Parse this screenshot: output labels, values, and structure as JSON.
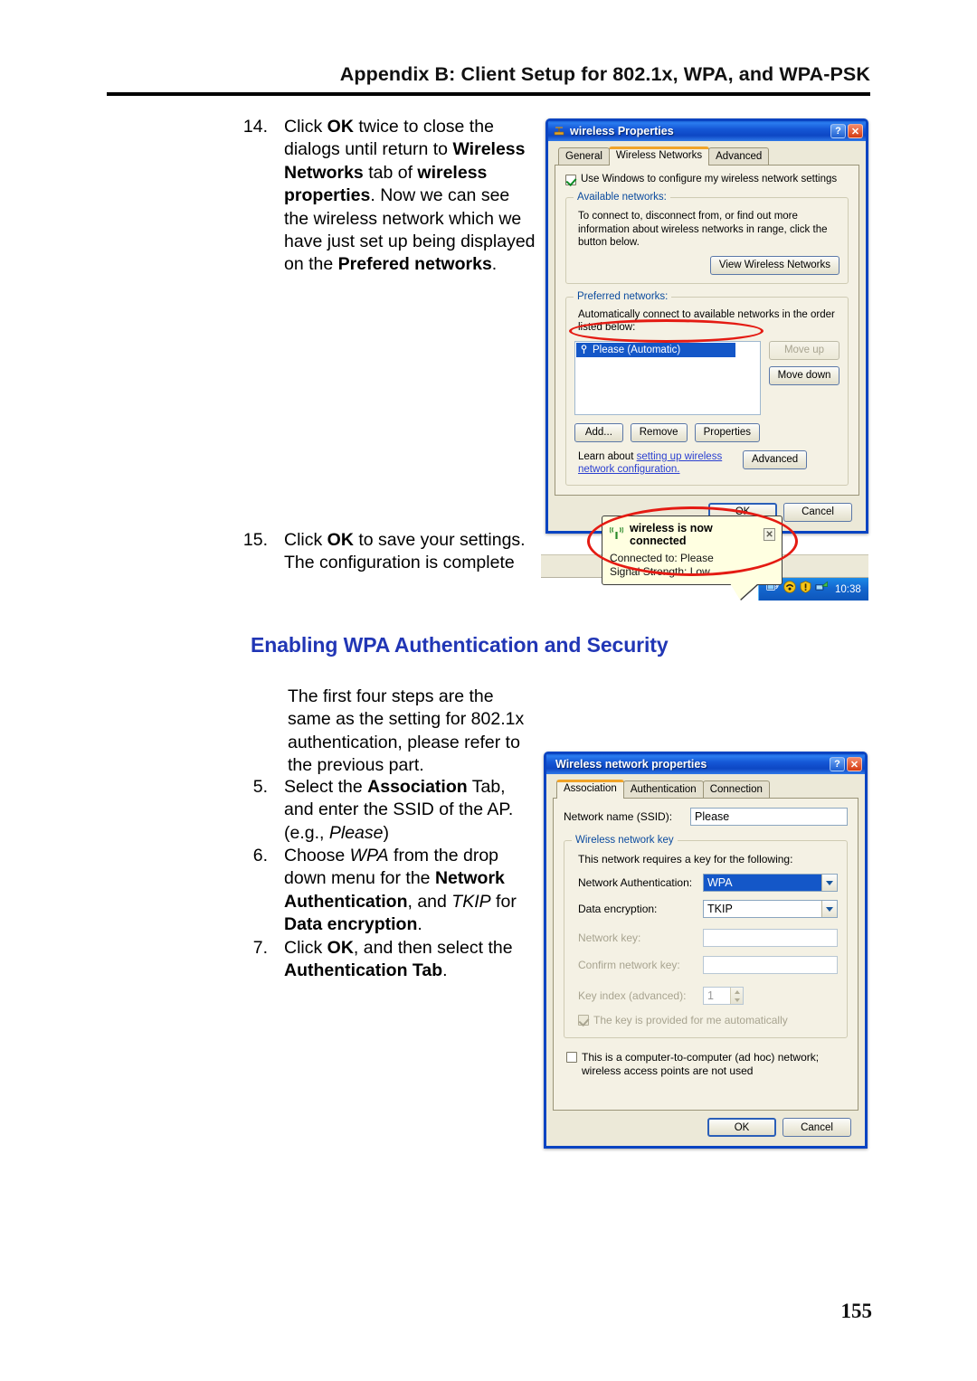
{
  "page": {
    "header_title": "Appendix B: Client Setup for 802.1x, WPA, and WPA-PSK",
    "page_number": "155",
    "section_heading": "Enabling WPA Authentication and Security"
  },
  "steps": {
    "s14_num": "14.",
    "s14_a": "Click ",
    "s14_b1": "OK",
    "s14_c": " twice to close the dialogs until return to ",
    "s14_b2": "Wireless Networks",
    "s14_d": " tab of ",
    "s14_b3": "wireless properties",
    "s14_e": ". Now we can see the wireless network which we have just set up being displayed on the ",
    "s14_b4": "Prefered networks",
    "s14_f": ".",
    "s15_num": "15.",
    "s15_a": "Click ",
    "s15_b1": "OK",
    "s15_c": " to save your settings. The configuration is complete",
    "intro_para": "The first four steps are the same as the setting for 802.1x authentication, please refer to the previous part.",
    "s5_num": "5.",
    "s5_a": "Select the ",
    "s5_b1": "Association",
    "s5_c": " Tab, and enter the SSID of the AP. (e.g., ",
    "s5_i1": "Please",
    "s5_d": ")",
    "s6_num": "6.",
    "s6_a": "Choose ",
    "s6_i1": "WPA",
    "s6_b": " from the drop down menu for the ",
    "s6_b1": "Network Authentication",
    "s6_c": ", and ",
    "s6_i2": "TKIP",
    "s6_d": " for ",
    "s6_b2": "Data encryption",
    "s6_e": ".",
    "s7_num": "7.",
    "s7_a": "Click ",
    "s7_b1": "OK",
    "s7_c": ", and then select the ",
    "s7_b2": "Authentication Tab",
    "s7_d": "."
  },
  "dialog1": {
    "title": "wireless Properties",
    "help_btn": "?",
    "close_btn": "✕",
    "tabs": [
      {
        "label": "General",
        "active": false
      },
      {
        "label": "Wireless Networks",
        "active": true
      },
      {
        "label": "Advanced",
        "active": false
      }
    ],
    "use_windows_checkbox": {
      "label": "Use Windows to configure my wireless network settings",
      "checked": true
    },
    "available_networks": {
      "legend": "Available networks:",
      "description": "To connect to, disconnect from, or find out more information about wireless networks in range, click the button below.",
      "view_button": "View Wireless Networks"
    },
    "preferred_networks": {
      "legend": "Preferred networks:",
      "description": "Automatically connect to available networks in the order listed below:",
      "list_items": [
        {
          "label": "Please (Automatic)",
          "selected": true
        }
      ],
      "move_up": "Move up",
      "move_down": "Move down",
      "add": "Add...",
      "remove": "Remove",
      "properties": "Properties",
      "learn_prefix": "Learn about ",
      "learn_link": "setting up wireless network configuration.",
      "advanced": "Advanced"
    },
    "ok": "OK",
    "cancel": "Cancel"
  },
  "balloon": {
    "title": "wireless is now connected",
    "close": "✕",
    "line1": "Connected to: Please",
    "line2": "Signal Strength: Low",
    "tray_time": "10:38",
    "icon": "wireless-signal-icon"
  },
  "dialog2": {
    "title": "Wireless network properties",
    "help_btn": "?",
    "close_btn": "✕",
    "tabs": [
      {
        "label": "Association",
        "active": true
      },
      {
        "label": "Authentication",
        "active": false
      },
      {
        "label": "Connection",
        "active": false
      }
    ],
    "ssid_label": "Network name (SSID):",
    "ssid_value": "Please",
    "key_group_legend": "Wireless network key",
    "key_group_desc": "This network requires a key for the following:",
    "net_auth_label": "Network Authentication:",
    "net_auth_value": "WPA",
    "data_enc_label": "Data encryption:",
    "data_enc_value": "TKIP",
    "net_key_label": "Network key:",
    "net_key_value": "",
    "confirm_key_label": "Confirm network key:",
    "confirm_key_value": "",
    "key_index_label": "Key index (advanced):",
    "key_index_value": "1",
    "auto_key_label": "The key is provided for me automatically",
    "auto_key_checked": true,
    "adhoc_label": "This is a computer-to-computer (ad hoc) network; wireless access points are not used",
    "adhoc_checked": false,
    "ok": "OK",
    "cancel": "Cancel"
  },
  "colors": {
    "heading_blue": "#2136b5",
    "xp_title_blue": "#0d47c4",
    "selection_blue": "#1457c8",
    "annotation_red": "#e41b13",
    "link_blue": "#2a3fd0",
    "group_legend_blue": "#0a4a9e"
  }
}
